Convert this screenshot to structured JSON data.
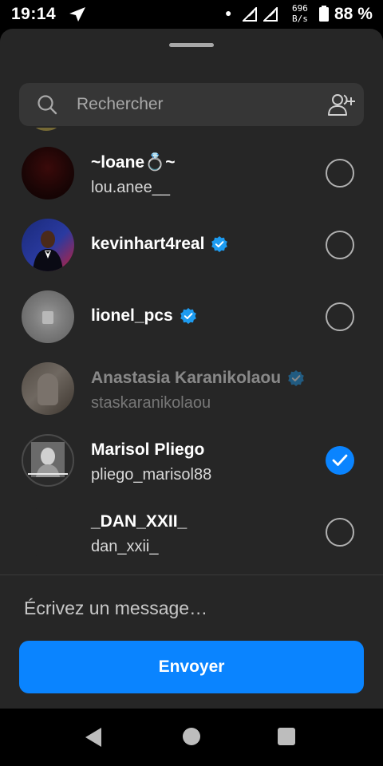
{
  "status_bar": {
    "time": "19:14",
    "speed_value": "696",
    "speed_unit": "B/s",
    "battery": "88 %"
  },
  "search": {
    "placeholder": "Rechercher"
  },
  "contacts": [
    {
      "name": "~loane💍~",
      "username": "lou.anee__",
      "verified": false,
      "selected": false
    },
    {
      "name": "kevinhart4real",
      "username": "",
      "verified": true,
      "selected": false
    },
    {
      "name": "lionel_pcs",
      "username": "",
      "verified": true,
      "selected": false
    },
    {
      "name": "Anastasia Karanikolaou",
      "username": "staskaranikolaou",
      "verified": true,
      "selected": false
    },
    {
      "name": "Marisol Pliego",
      "username": "pliego_marisol88",
      "verified": false,
      "selected": true
    },
    {
      "name": "_DAN_XXII_",
      "username": "dan_xxii_",
      "verified": false,
      "selected": false
    }
  ],
  "compose": {
    "placeholder": "Écrivez un message…"
  },
  "send_button": {
    "label": "Envoyer"
  },
  "colors": {
    "accent": "#0a84ff",
    "sheet_bg": "#262626",
    "search_bg": "#363636"
  }
}
